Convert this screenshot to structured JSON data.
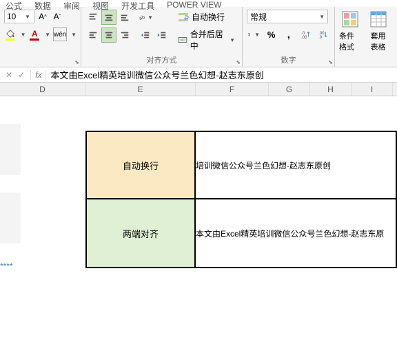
{
  "tabs": {
    "t1": "公式",
    "t2": "数据",
    "t3": "审阅",
    "t4": "视图",
    "t5": "开发工具",
    "t6": "POWER VIEW"
  },
  "font": {
    "size": "10"
  },
  "align": {
    "wrap_label": "自动换行",
    "merge_label": "合并后居中",
    "group_label": "对齐方式"
  },
  "number": {
    "format": "常规",
    "group_label": "数字"
  },
  "styles": {
    "cond_fmt": "条件格式",
    "table_fmt": "套用\n表格"
  },
  "formula_bar": {
    "fx": "fx",
    "value": "本文由Excel精英培训微信公众号兰色幻想-赵志东原创"
  },
  "columns": {
    "D": "D",
    "E": "E",
    "F": "F",
    "G": "G",
    "H": "H",
    "I": "I"
  },
  "cells": {
    "e_row1": "自动换行",
    "f_row1": "培训微信公众号兰色幻想-赵志东原创",
    "e_row2": "两端对齐",
    "f_row2": "本文由Excel精英培训微信公众号兰色幻想-赵志东原",
    "stars": "****"
  }
}
